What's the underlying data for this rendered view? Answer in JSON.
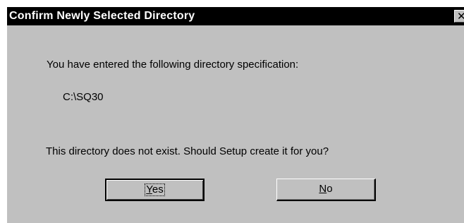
{
  "window": {
    "title": "Confirm Newly Selected Directory",
    "close_icon": "close-icon"
  },
  "message": {
    "line1": "You have entered the following directory specification:",
    "path": "C:\\SQ30",
    "line2": "This directory does not exist.  Should Setup create it for you?"
  },
  "buttons": {
    "yes": {
      "mnemonic": "Y",
      "rest": "es",
      "default": true
    },
    "no": {
      "mnemonic": "N",
      "rest": "o",
      "default": false
    }
  },
  "colors": {
    "face": "#c0c0c0",
    "title_bar": "#000000",
    "title_text": "#ffffff"
  }
}
